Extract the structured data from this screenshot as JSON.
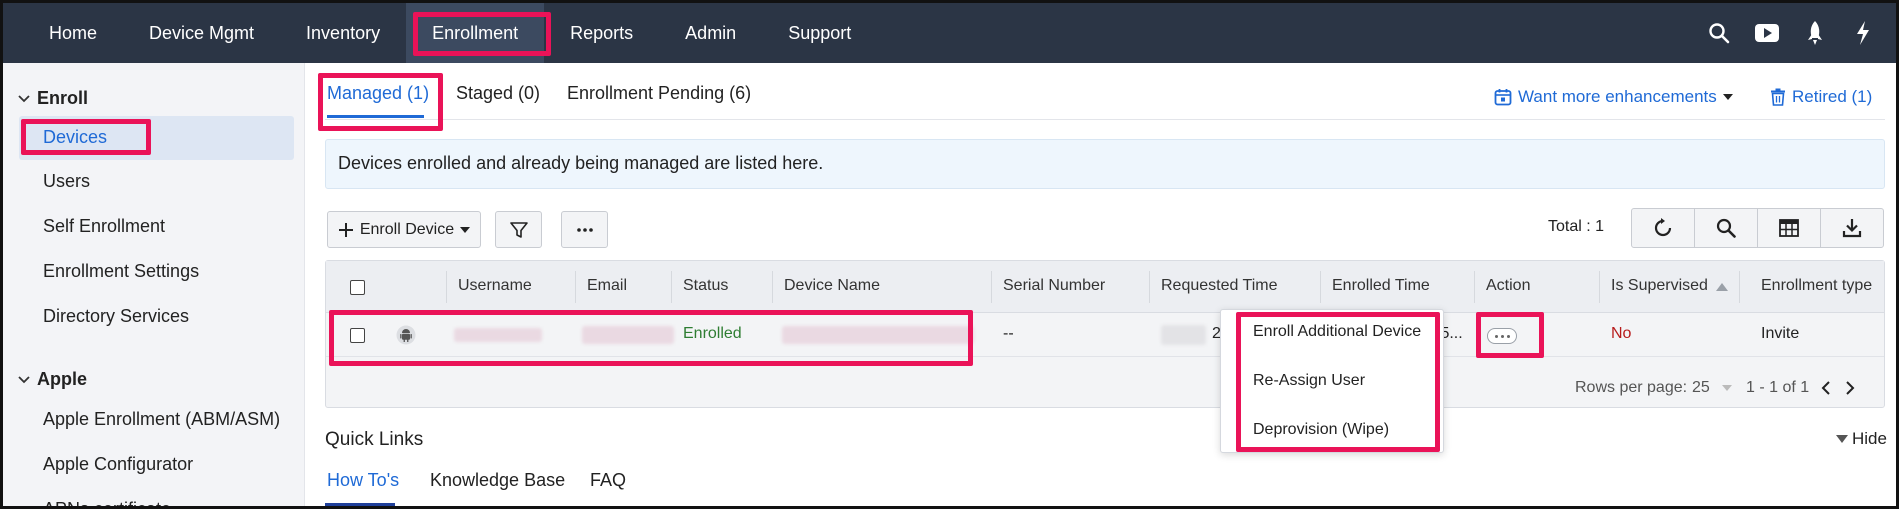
{
  "nav": {
    "items": [
      "Home",
      "Device Mgmt",
      "Inventory",
      "Enrollment",
      "Reports",
      "Admin",
      "Support"
    ],
    "active": "Enrollment",
    "icons": [
      "search-icon",
      "youtube-icon",
      "rocket-icon",
      "lightning-icon"
    ]
  },
  "sidebar": {
    "groups": [
      {
        "label": "Enroll",
        "items": [
          "Devices",
          "Users",
          "Self Enrollment",
          "Enrollment Settings",
          "Directory Services"
        ]
      },
      {
        "label": "Apple",
        "items": [
          "Apple Enrollment (ABM/ASM)",
          "Apple Configurator",
          "APNs certificate"
        ]
      }
    ],
    "active": "Devices"
  },
  "tabs": {
    "items": [
      "Managed (1)",
      "Staged (0)",
      "Enrollment Pending (6)"
    ],
    "active": "Managed (1)",
    "enhancements": "Want more enhancements",
    "retired": "Retired (1)"
  },
  "info": "Devices enrolled and already being managed are listed here.",
  "toolbar": {
    "enroll_device": "Enroll Device",
    "total": "Total : 1"
  },
  "table": {
    "columns": [
      "Username",
      "Email",
      "Status",
      "Device Name",
      "Serial Number",
      "Requested Time",
      "Enrolled Time",
      "Action",
      "Is Supervised",
      "Enrollment type"
    ],
    "row": {
      "status": "Enrolled",
      "serial": "--",
      "requested_partial": "2",
      "enrolled_partial": ":5...",
      "supervised": "No",
      "enrollment_type": "Invite"
    },
    "pagination": {
      "rows_label": "Rows per page:",
      "rows_value": "25",
      "range": "1 - 1 of 1"
    }
  },
  "action_menu": [
    "Enroll Additional Device",
    "Re-Assign User",
    "Deprovision (Wipe)"
  ],
  "quick_links": {
    "title": "Quick Links",
    "tabs": [
      "How To's",
      "Knowledge Base",
      "FAQ"
    ],
    "active": "How To's",
    "hide": "Hide"
  },
  "colors": {
    "nav_bg": "#2b3545",
    "accent": "#1f6ad6",
    "highlight": "#ea1358",
    "enrolled": "#2e7d32",
    "no": "#b71c1c"
  }
}
